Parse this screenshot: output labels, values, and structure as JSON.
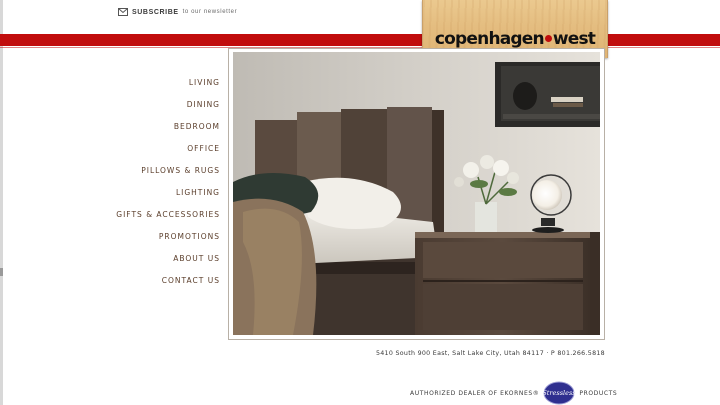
{
  "header": {
    "newsletter": {
      "icon": "envelope-icon",
      "strong": "SUBSCRIBE",
      "small": "to our newsletter"
    },
    "logo": {
      "part1": "copenhagen",
      "part2": "west"
    },
    "colors": {
      "brand_red": "#c10d0d",
      "nav_text": "#5a3d2a"
    }
  },
  "nav": {
    "items": [
      {
        "label": "LIVING"
      },
      {
        "label": "DINING"
      },
      {
        "label": "BEDROOM"
      },
      {
        "label": "OFFICE"
      },
      {
        "label": "PILLOWS & RUGS"
      },
      {
        "label": "LIGHTING"
      },
      {
        "label": "GIFTS & ACCESSORIES"
      },
      {
        "label": "PROMOTIONS"
      },
      {
        "label": "ABOUT US"
      },
      {
        "label": "CONTACT US"
      }
    ]
  },
  "hero": {
    "image": "bedroom-scene"
  },
  "footer": {
    "address": "5410 South 900 East, Salt Lake City, Utah 84117 · P 801.266.5818",
    "dealer_prefix": "AUTHORIZED DEALER OF EKORNES®",
    "badge": {
      "text": "Stressless",
      "icon": "stressless-badge-icon"
    },
    "dealer_suffix": "PRODUCTS"
  }
}
